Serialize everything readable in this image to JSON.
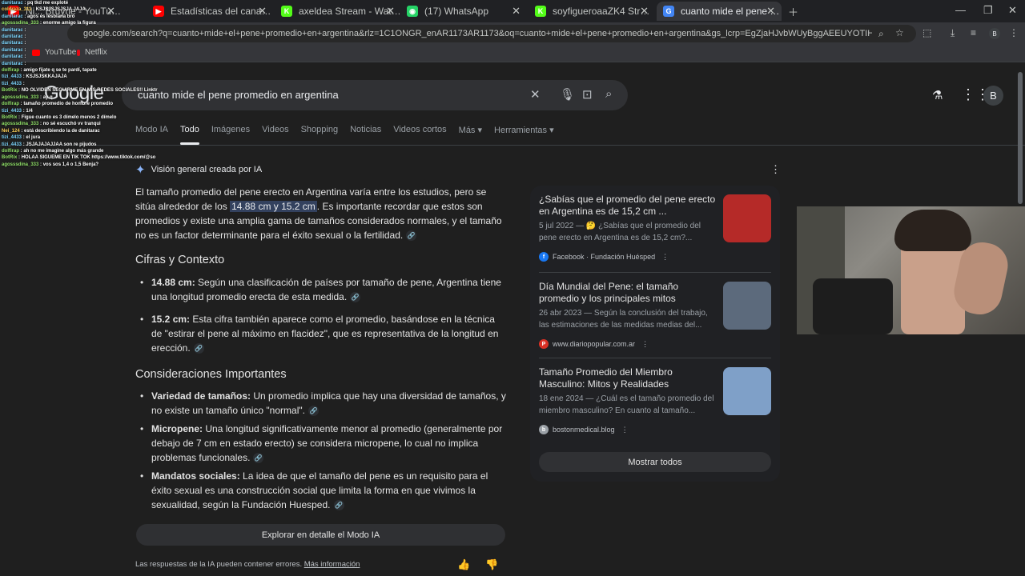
{
  "tabs": [
    {
      "title": "Ni... Bruyne - YouTube",
      "color": "#ff0000",
      "glyph": "▶"
    },
    {
      "title": "Estadísticas del canal - YouTube",
      "color": "#ff0000",
      "glyph": "▶"
    },
    {
      "title": "axeldea Stream - Watch Live on",
      "color": "#53fc18",
      "glyph": "K"
    },
    {
      "title": "(17) WhatsApp",
      "color": "#25d366",
      "glyph": "◉"
    },
    {
      "title": "soyfigueroaaZK4 Stream - Watc",
      "color": "#53fc18",
      "glyph": "K"
    },
    {
      "title": "cuanto mide el pene promedio",
      "color": "#4285f4",
      "glyph": "G",
      "active": true
    }
  ],
  "url": "google.com/search?q=cuanto+mide+el+pene+promedio+en+argentina&rlz=1C1ONGR_enAR1173AR1173&oq=cuanto+mide+el+pene+promedio+en+argentina&gs_lcrp=EgZjaHJvbWUyBggAEEUYOTIHCAEQIRiPAtIBCDYxNzdqMGo3qA...",
  "bookmarks": [
    {
      "label": "YouTube",
      "color": "#ff0000"
    },
    {
      "label": "Netflix",
      "color": "#e50914"
    }
  ],
  "chat": [
    {
      "user": "danitarac",
      "msg": "pq tkd me exploté",
      "c": ""
    },
    {
      "user": "coldraza_311",
      "msg": "KSJSJSJSJSJA JAJA",
      "c": "y"
    },
    {
      "user": "danitarac",
      "msg": "agos es lesbiana bro",
      "c": ""
    },
    {
      "user": "agosssdina_333",
      "msg": "enorme amigo la figura",
      "c": "g"
    },
    {
      "user": "danitarac",
      "msg": "",
      "c": ""
    },
    {
      "user": "danitarac",
      "msg": "",
      "c": ""
    },
    {
      "user": "danitarac",
      "msg": "",
      "c": ""
    },
    {
      "user": "danitarac",
      "msg": "",
      "c": ""
    },
    {
      "user": "danitarac",
      "msg": "",
      "c": ""
    },
    {
      "user": "danitarac",
      "msg": "",
      "c": ""
    },
    {
      "user": "dolfirap",
      "msg": "amigo fijate q se te pardí, tapate",
      "c": "g"
    },
    {
      "user": "tizi_4433",
      "msg": "KSJSJSKKAJAJA",
      "c": ""
    },
    {
      "user": "tizi_4433",
      "msg": "",
      "c": ""
    },
    {
      "user": "BotRix",
      "msg": "NO OLVIDEN SEGUIRME EN MIS REDES SOCIALES!! Linktr",
      "c": "g"
    },
    {
      "user": "agosssdina_333",
      "msg": "ay q",
      "c": "g"
    },
    {
      "user": "dolfirap",
      "msg": "tamaño promedio de hombre promedio",
      "c": "g"
    },
    {
      "user": "tizi_4433",
      "msg": "1/4",
      "c": ""
    },
    {
      "user": "BotRix",
      "msg": "Figue cuanto es 3 dímelo menos 2 dímelo",
      "c": "g"
    },
    {
      "user": "agosssdina_333",
      "msg": "no sé escuchó vv tranqui",
      "c": "g"
    },
    {
      "user": "Nei_124",
      "msg": "está describiendo la de danitarac",
      "c": "y"
    },
    {
      "user": "tizi_4433",
      "msg": "el jura",
      "c": ""
    },
    {
      "user": "tizi_4433",
      "msg": "JSJAJAJAJJAA son re pijudos",
      "c": ""
    },
    {
      "user": "dolfirap",
      "msg": "ah no me imagine algo más grande",
      "c": "g"
    },
    {
      "user": "BotRix",
      "msg": "HOLAA SIGUEME EN TIK TOK https://www.tiktok.com/@so",
      "c": "g"
    },
    {
      "user": "agosssdina_333",
      "msg": "vos sos 1,4 o 1,5 Benja?",
      "c": "g"
    }
  ],
  "search": {
    "logo": "Google",
    "query": "cuanto mide el pene promedio en argentina",
    "avatar": "B"
  },
  "nav": [
    "Modo IA",
    "Todo",
    "Imágenes",
    "Videos",
    "Shopping",
    "Noticias",
    "Videos cortos",
    "Más ▾",
    "Herramientas ▾"
  ],
  "ai": {
    "header": "Visión general creada por IA",
    "intro_pre": "El tamaño promedio del pene erecto en Argentina varía entre los estudios, pero se sitúa alrededor de los ",
    "intro_hl": "14.88 cm y 15.2 cm",
    "intro_post": ". Es importante recordar que estos son promedios y existe una amplia gama de tamaños considerados normales, y el tamaño no es un factor determinante para el éxito sexual o la fertilidad.",
    "h1": "Cifras y Contexto",
    "b1_bold": "14.88 cm:",
    "b1_text": " Según una clasificación de países por tamaño de pene, Argentina tiene una longitud promedio erecta de esta medida.",
    "b2_bold": "15.2 cm:",
    "b2_text": " Esta cifra también aparece como el promedio, basándose en la técnica de \"estirar el pene al máximo en flacidez\", que es representativa de la longitud en erección.",
    "h2": "Consideraciones Importantes",
    "b3_bold": "Variedad de tamaños:",
    "b3_text": " Un promedio implica que hay una diversidad de tamaños, y no existe un tamaño único \"normal\".",
    "b4_bold": "Micropene:",
    "b4_text": " Una longitud significativamente menor al promedio (generalmente por debajo de 7 cm en estado erecto) se considera micropene, lo cual no implica problemas funcionales.",
    "b5_bold": "Mandatos sociales:",
    "b5_text": " La idea de que el tamaño del pene es un requisito para el éxito sexual es una construcción social que limita la forma en que vivimos la sexualidad, según la Fundación Huesped.",
    "explore": "Explorar en detalle el Modo IA",
    "disclaimer": "Las respuestas de la IA pueden contener errores.",
    "more_info": "Más información"
  },
  "cards": [
    {
      "title": "¿Sabías que el promedio del pene erecto en Argentina es de 15,2 cm ...",
      "snippet": "5 jul 2022 — 🤔 ¿Sabías que el promedio del pene erecto en Argentina es de 15,2 cm?...",
      "source": "Facebook · Fundación Huésped",
      "icon_color": "#1877f2",
      "icon": "f",
      "img": "#b52a28"
    },
    {
      "title": "Día Mundial del Pene: el tamaño promedio y los principales mitos",
      "snippet": "26 abr 2023 — Según la conclusión del trabajo, las estimaciones de las medidas medias del...",
      "source": "www.diariopopular.com.ar",
      "icon_color": "#d93025",
      "icon": "P",
      "img": "#5c6a7c"
    },
    {
      "title": "Tamaño Promedio del Miembro Masculino: Mitos y Realidades",
      "snippet": "18 ene 2024 — ¿Cuál es el tamaño promedio del miembro masculino? En cuanto al tamaño...",
      "source": "bostonmedical.blog",
      "icon_color": "#9aa0a6",
      "icon": "b",
      "img": "#7fa0c8"
    }
  ],
  "show_all": "Mostrar todos"
}
